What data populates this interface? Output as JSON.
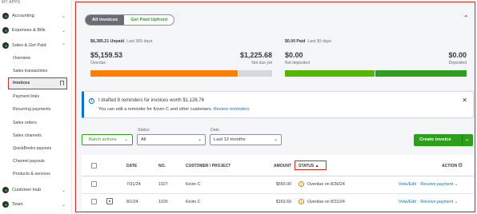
{
  "sidebar": {
    "header": "MY APPS",
    "sections": [
      {
        "label": "Accounting",
        "chevron": "⌄"
      },
      {
        "label": "Expenses & Bills",
        "chevron": "⌄"
      },
      {
        "label": "Sales & Get Paid",
        "chevron": "⌃"
      },
      {
        "label": "Customer Hub",
        "chevron": "⌄"
      },
      {
        "label": "Team",
        "chevron": "⌄"
      }
    ],
    "sales_items": [
      "Overview",
      "Sales transactions",
      "Invoices",
      "Payment links",
      "Recurring payments",
      "Sales orders",
      "Sales channels",
      "QuickBooks payouts",
      "Channel payouts",
      "Products & services"
    ]
  },
  "tabs": {
    "all_invoices": "All invoices",
    "get_paid_upfront": "Get Paid Upfront"
  },
  "summary": {
    "unpaid_total": "$6,385.21 Unpaid",
    "unpaid_period": "Last 365 days",
    "paid_total": "$0.00 Paid",
    "paid_period": "Last 30 days",
    "overdue_amount": "$5,159.53",
    "overdue_label": "Overdue",
    "not_due_amount": "$1,225.68",
    "not_due_label": "Not due yet",
    "not_deposited_amount": "$0.00",
    "not_deposited_label": "Not deposited",
    "deposited_amount": "$0.00",
    "deposited_label": "Deposited",
    "colors": {
      "overdue": "#ff8000",
      "not_due": "#d4d7dc",
      "not_deposited": "#53b700",
      "deposited": "#2ca01c"
    }
  },
  "banner": {
    "title": "I drafted 8 reminders for invoices worth $1,126.76",
    "body": "You can edit a reminder for Kevin C and other customers.",
    "link": "Review reminders"
  },
  "filters": {
    "batch_actions": "Batch actions",
    "status_label": "Status",
    "status_value": "All",
    "date_label": "Date",
    "date_value": "Last 12 months",
    "create_invoice": "Create invoice"
  },
  "table": {
    "headers": {
      "date": "DATE",
      "no": "NO.",
      "customer": "CUSTOMER / PROJECT",
      "amount": "AMOUNT",
      "status": "STATUS ▲",
      "action": "ACTION"
    },
    "rows": [
      {
        "date": "7/31/24",
        "no": "1027",
        "customer": "Kevin C",
        "amount": "$550.00",
        "status": "Overdue on 8/30/24",
        "view": "View/Edit",
        "receive": "Receive payment",
        "recurring": false
      },
      {
        "date": "8/1/24",
        "no": "1026",
        "customer": "Kevin C",
        "amount": "$163.69",
        "status": "Overdue on 8/31/24",
        "view": "View/Edit",
        "receive": "Receive payment",
        "recurring": true
      }
    ]
  }
}
